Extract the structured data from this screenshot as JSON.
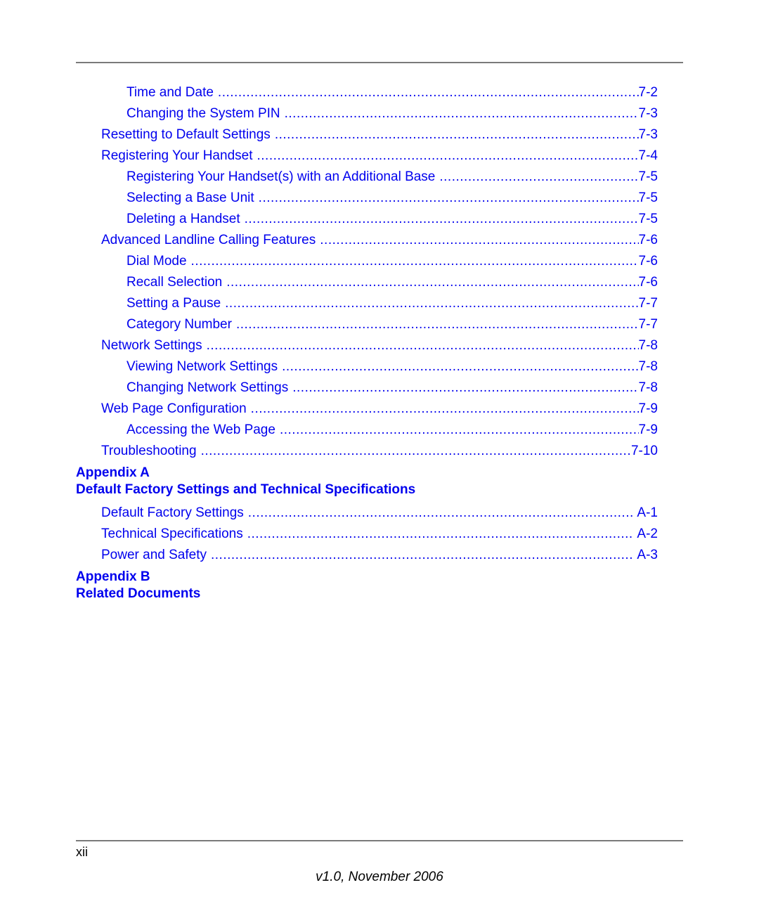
{
  "toc": {
    "entries": [
      {
        "level": 2,
        "title": "Time and Date",
        "page": "7-2"
      },
      {
        "level": 2,
        "title": "Changing the System PIN",
        "page": "7-3"
      },
      {
        "level": 1,
        "title": "Resetting to Default Settings",
        "page": "7-3"
      },
      {
        "level": 1,
        "title": "Registering Your Handset",
        "page": "7-4"
      },
      {
        "level": 2,
        "title": "Registering Your Handset(s) with an Additional Base",
        "page": "7-5"
      },
      {
        "level": 2,
        "title": "Selecting a Base Unit",
        "page": "7-5"
      },
      {
        "level": 2,
        "title": "Deleting a Handset",
        "page": "7-5"
      },
      {
        "level": 1,
        "title": "Advanced Landline Calling Features",
        "page": "7-6"
      },
      {
        "level": 2,
        "title": "Dial Mode",
        "page": "7-6"
      },
      {
        "level": 2,
        "title": "Recall Selection",
        "page": "7-6"
      },
      {
        "level": 2,
        "title": "Setting a Pause",
        "page": "7-7"
      },
      {
        "level": 2,
        "title": "Category Number",
        "page": "7-7"
      },
      {
        "level": 1,
        "title": "Network Settings",
        "page": "7-8"
      },
      {
        "level": 2,
        "title": "Viewing Network Settings",
        "page": "7-8"
      },
      {
        "level": 2,
        "title": "Changing Network Settings",
        "page": "7-8"
      },
      {
        "level": 1,
        "title": "Web Page Configuration",
        "page": "7-9"
      },
      {
        "level": 2,
        "title": "Accessing the Web Page",
        "page": "7-9"
      },
      {
        "level": 1,
        "title": "Troubleshooting",
        "page": "7-10"
      }
    ],
    "appendix_a": {
      "label": "Appendix A",
      "title": "Default Factory Settings and Technical Specifications",
      "entries": [
        {
          "level": 1,
          "title": "Default Factory Settings",
          "page": "A-1"
        },
        {
          "level": 1,
          "title": "Technical Specifications",
          "page": "A-2"
        },
        {
          "level": 1,
          "title": "Power and Safety",
          "page": "A-3"
        }
      ]
    },
    "appendix_b": {
      "label": "Appendix B",
      "title": "Related Documents"
    }
  },
  "footer": {
    "page_number": "xii",
    "version": "v1.0, November 2006"
  },
  "colors": {
    "link": "#0000ee",
    "rule": "#7a7a7a"
  }
}
